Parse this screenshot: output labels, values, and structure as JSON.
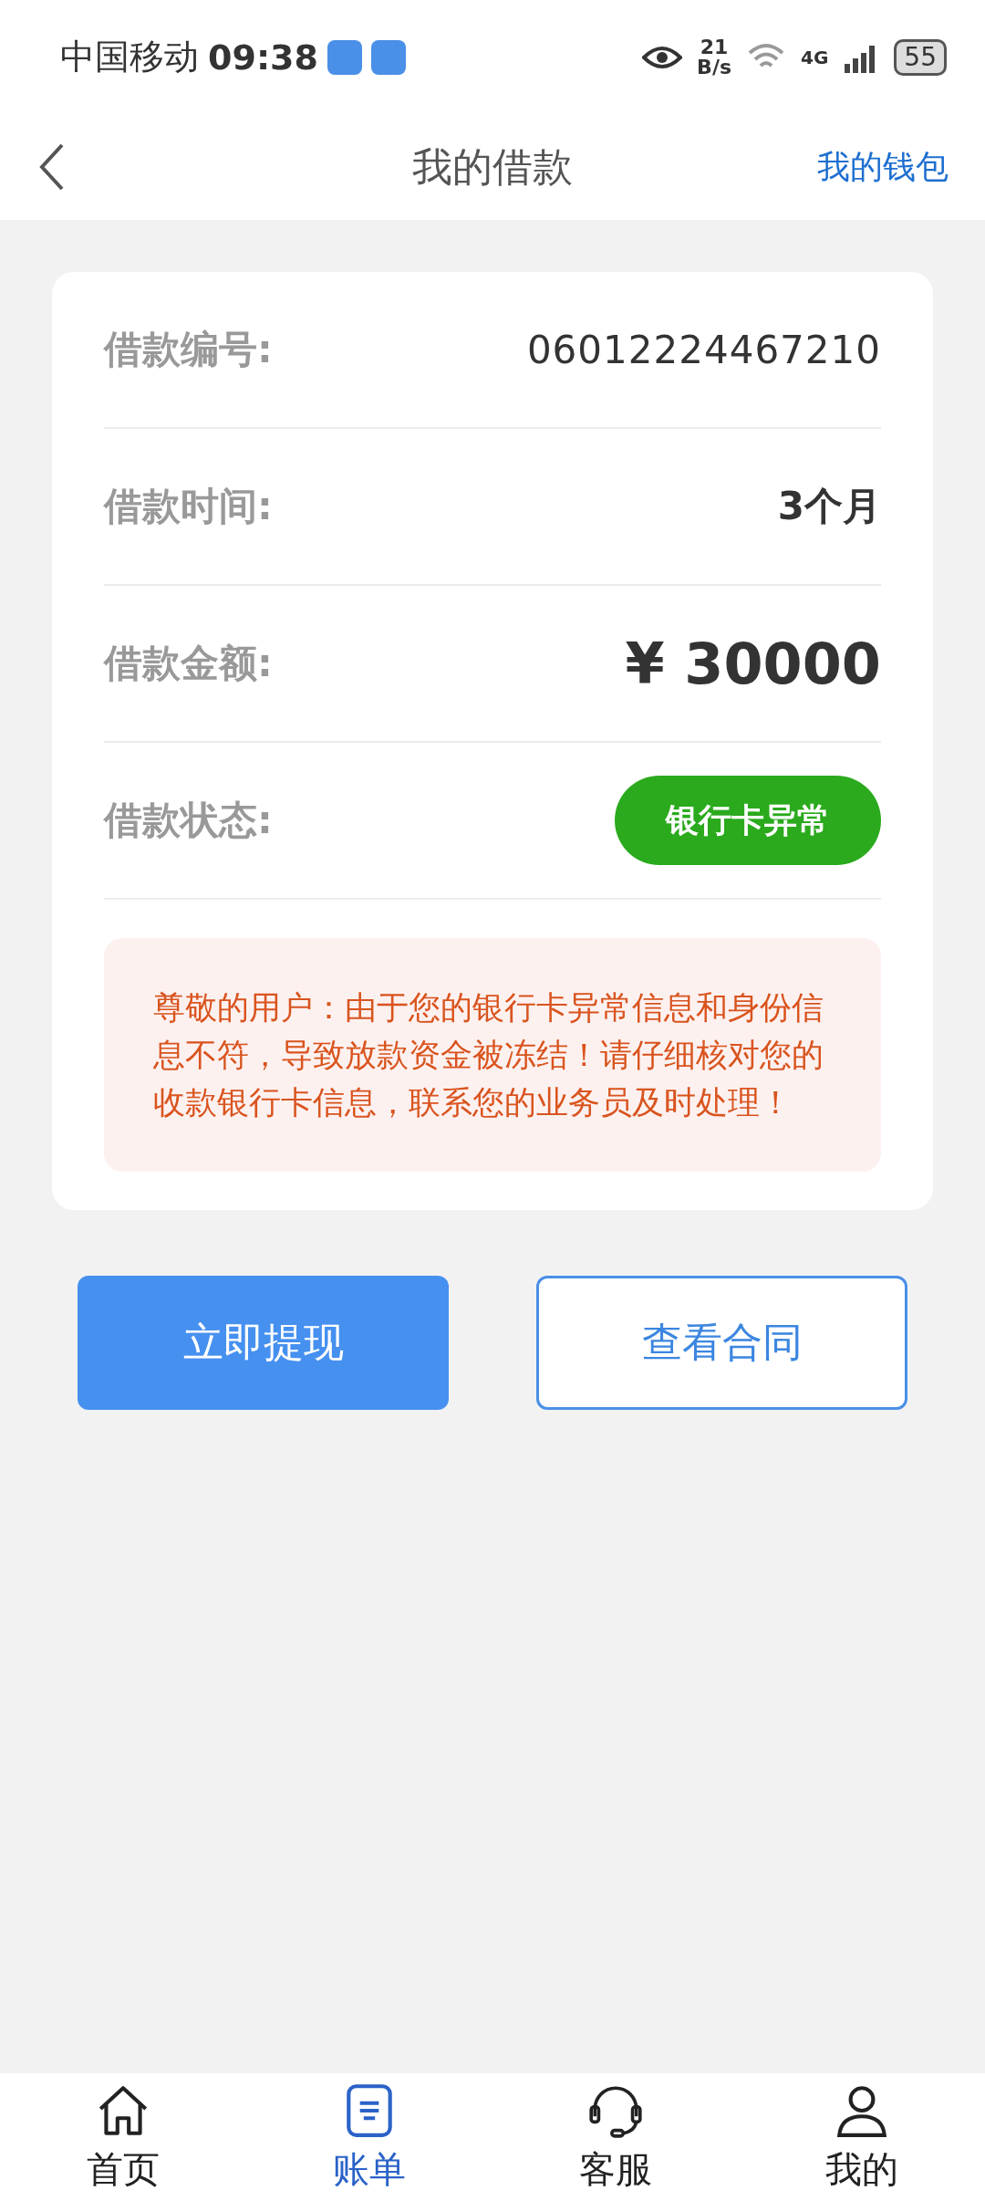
{
  "status_bar": {
    "carrier": "中国移动",
    "time": "09:38",
    "net_speed": "21",
    "net_unit": "B/s",
    "network": "4G",
    "battery": "55"
  },
  "header": {
    "title": "我的借款",
    "action": "我的钱包"
  },
  "loan_fields": [
    {
      "kind": "text",
      "label": "借款编号:",
      "value": "06012224467210"
    },
    {
      "kind": "bold",
      "label": "借款时间:",
      "value": "3个月"
    },
    {
      "kind": "amount",
      "label": "借款金额:",
      "value": "¥ 30000"
    },
    {
      "kind": "badge",
      "label": "借款状态:",
      "value": "银行卡异常",
      "color": "#2aaa1c"
    }
  ],
  "notice": "尊敬的用户：由于您的银行卡异常信息和身份信息不符，导致放款资金被冻结！请仔细核对您的收款银行卡信息，联系您的业务员及时处理！",
  "buttons": [
    {
      "kind": "primary",
      "label": "立即提现"
    },
    {
      "kind": "outline",
      "label": "查看合同"
    }
  ],
  "tabs": [
    {
      "kind": "home",
      "label": "首页",
      "selected": false
    },
    {
      "kind": "bill",
      "label": "账单",
      "selected": true
    },
    {
      "kind": "service",
      "label": "客服",
      "selected": false
    },
    {
      "kind": "me",
      "label": "我的",
      "selected": false
    }
  ]
}
